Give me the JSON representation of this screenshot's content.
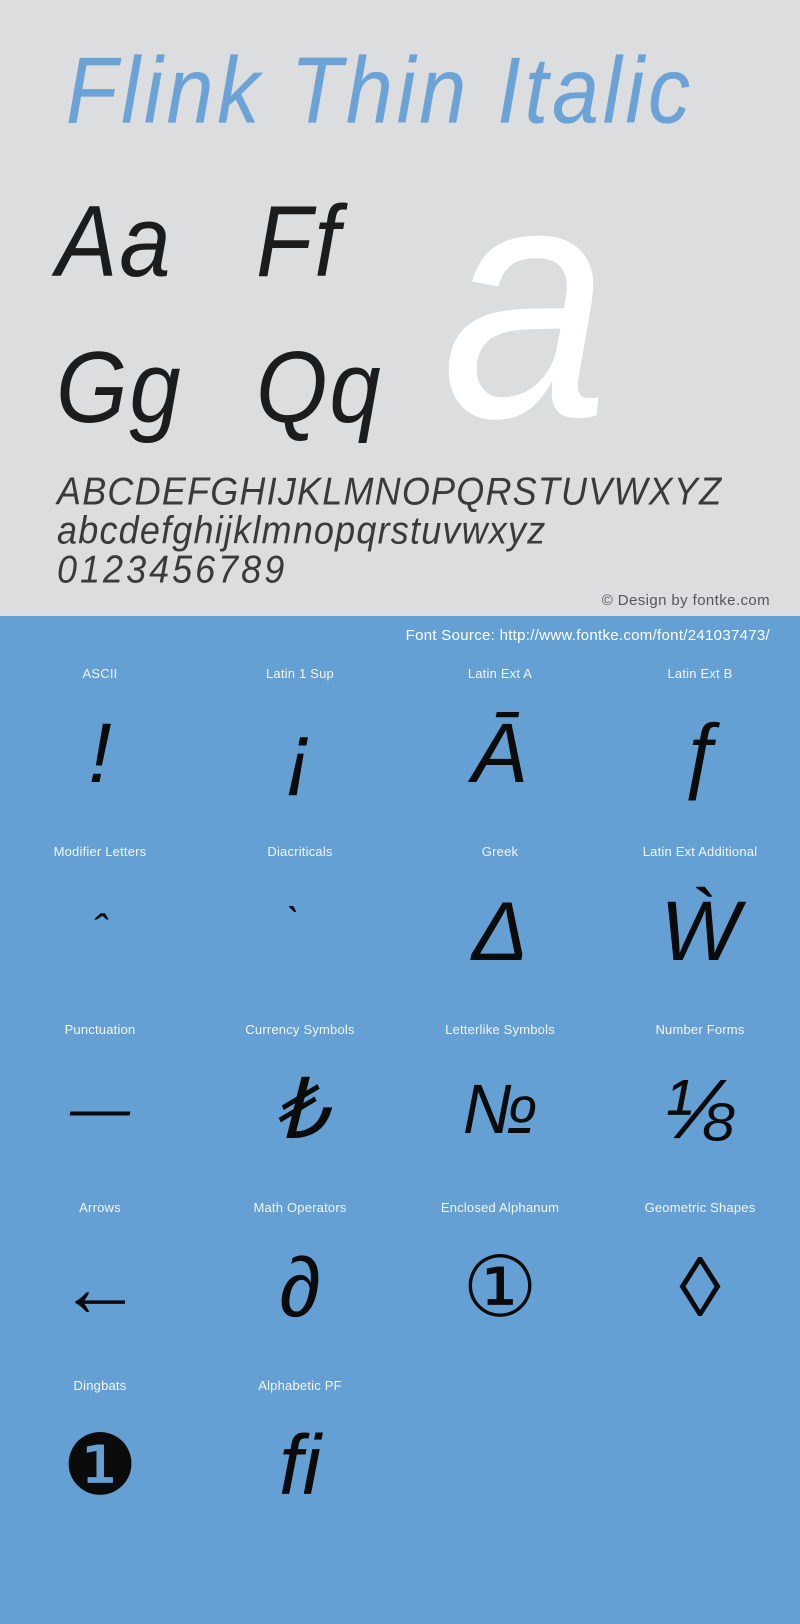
{
  "specimen": {
    "title": "Flink Thin Italic",
    "watermark_glyph": "a",
    "samples": [
      {
        "pair": "Aa"
      },
      {
        "pair": "Ff"
      },
      {
        "pair": "Gg"
      },
      {
        "pair": "Qq"
      }
    ],
    "uppercase": "ABCDEFGHIJKLMNOPQRSTUVWXYZ",
    "lowercase": "abcdefghijklmnopqrstuvwxyz",
    "digits": "0123456789",
    "copyright": "© Design by fontke.com",
    "colors": {
      "title": "#6ba3d6",
      "background": "#dcdddf",
      "glyph": "#1c1c1c",
      "watermark": "#ffffff"
    }
  },
  "coverage": {
    "font_source": "Font Source: http://www.fontke.com/font/241037473/",
    "background": "#64a0d4",
    "label_color": "#f2f6fb",
    "cells": [
      {
        "label": "ASCII",
        "glyph": "!",
        "style": ""
      },
      {
        "label": "Latin 1 Sup",
        "glyph": "¡",
        "style": ""
      },
      {
        "label": "Latin Ext A",
        "glyph": "Ā",
        "style": ""
      },
      {
        "label": "Latin Ext B",
        "glyph": "ƒ",
        "style": ""
      },
      {
        "label": "Modifier Letters",
        "glyph": "ˆ",
        "style": "tiny"
      },
      {
        "label": "Diacriticals",
        "glyph": "̀",
        "style": "tiny"
      },
      {
        "label": "Greek",
        "glyph": "Δ",
        "style": ""
      },
      {
        "label": "Latin Ext Additional",
        "glyph": "Ẁ",
        "style": ""
      },
      {
        "label": "Punctuation",
        "glyph": "—",
        "style": "small"
      },
      {
        "label": "Currency Symbols",
        "glyph": "₺",
        "style": ""
      },
      {
        "label": "Letterlike Symbols",
        "glyph": "№",
        "style": "wide"
      },
      {
        "label": "Number Forms",
        "glyph": "⅛",
        "style": ""
      },
      {
        "label": "Arrows",
        "glyph": "←",
        "style": "upright"
      },
      {
        "label": "Math Operators",
        "glyph": "∂",
        "style": ""
      },
      {
        "label": "Enclosed Alphanum",
        "glyph": "①",
        "style": "upright"
      },
      {
        "label": "Geometric Shapes",
        "glyph": "◊",
        "style": "upright"
      },
      {
        "label": "Dingbats",
        "glyph": "❶",
        "style": "upright"
      },
      {
        "label": "Alphabetic PF",
        "glyph": "ﬁ",
        "style": ""
      },
      {
        "label": "",
        "glyph": "",
        "style": ""
      },
      {
        "label": "",
        "glyph": "",
        "style": ""
      }
    ]
  }
}
